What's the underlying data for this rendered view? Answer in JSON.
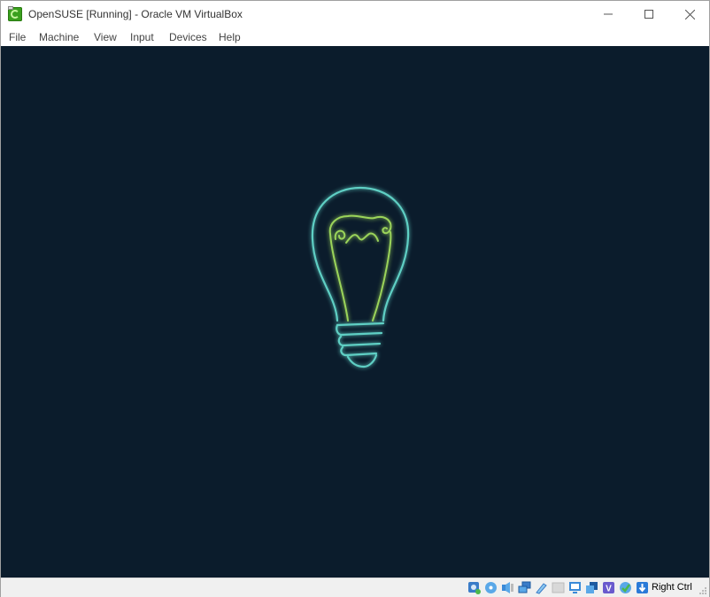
{
  "window": {
    "title": "OpenSUSE [Running] - Oracle VM VirtualBox",
    "app_icon": "virtualbox-opensuse-icon",
    "controls": {
      "minimize": "minimize-icon",
      "maximize": "maximize-icon",
      "close": "close-icon"
    }
  },
  "menubar": {
    "items": [
      {
        "label": "File"
      },
      {
        "label": "Machine"
      },
      {
        "label": "View"
      },
      {
        "label": "Input"
      },
      {
        "label": "Devices"
      },
      {
        "label": "Help"
      }
    ]
  },
  "vm_display": {
    "background_color": "#0b1c2c",
    "splash_graphic": "opensuse-lightbulb-chameleon",
    "bulb_color": "#5ecfc4",
    "chameleon_color": "#9bd45a"
  },
  "statusbar": {
    "indicators": [
      {
        "name": "hard-disk-icon"
      },
      {
        "name": "optical-drive-icon"
      },
      {
        "name": "audio-icon"
      },
      {
        "name": "network-icon"
      },
      {
        "name": "usb-icon"
      },
      {
        "name": "shared-folders-icon"
      },
      {
        "name": "display-icon"
      },
      {
        "name": "video-capture-icon"
      },
      {
        "name": "vt-x-icon"
      },
      {
        "name": "guest-additions-icon"
      },
      {
        "name": "mouse-integration-icon"
      }
    ],
    "host_key": "Right Ctrl"
  }
}
